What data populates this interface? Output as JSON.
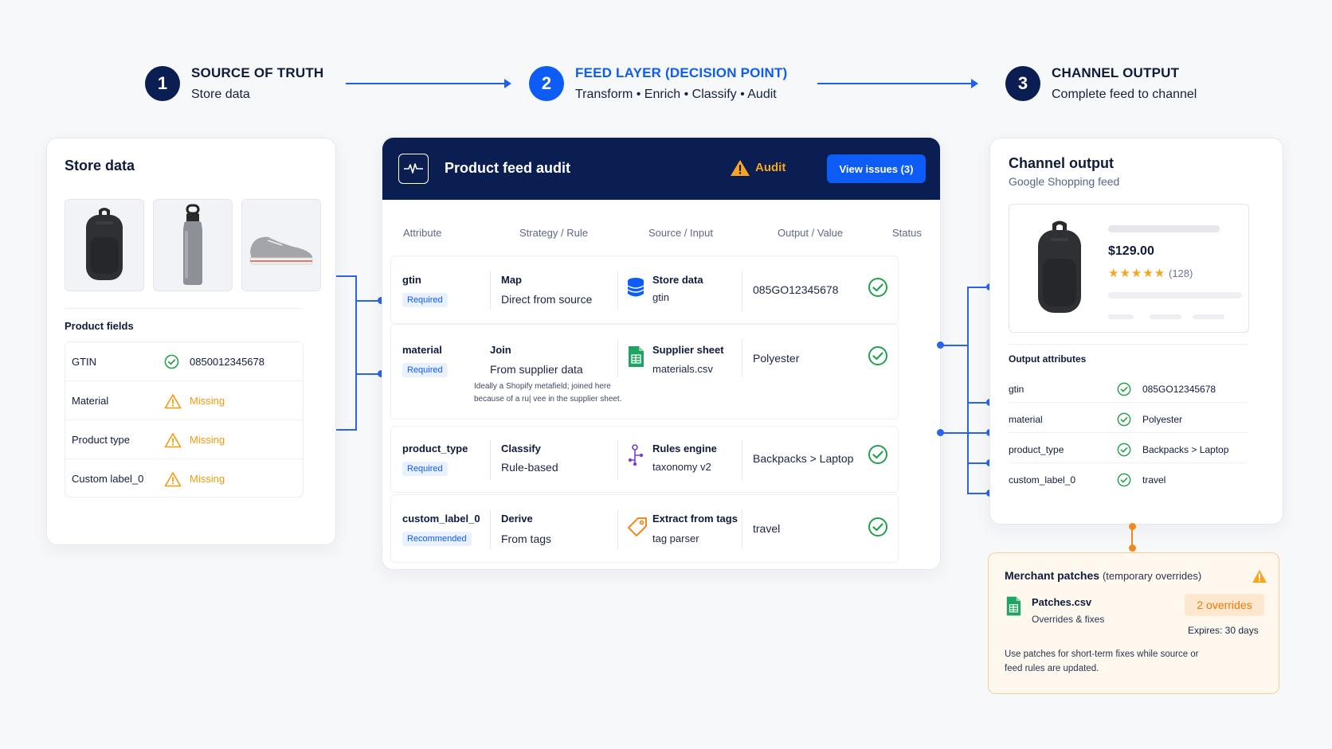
{
  "steps": [
    {
      "num": "1",
      "title": "SOURCE OF TRUTH",
      "subtitle": "Store data"
    },
    {
      "num": "2",
      "title": "FEED LAYER (DECISION POINT)",
      "subtitle": "Transform • Enrich • Classify • Audit"
    },
    {
      "num": "3",
      "title": "CHANNEL OUTPUT",
      "subtitle": "Complete feed to channel"
    }
  ],
  "store": {
    "title": "Store data",
    "fields_label": "Product fields",
    "fields": [
      {
        "name": "GTIN",
        "value": "0850012345678",
        "status": "ok"
      },
      {
        "name": "Material",
        "value": "Missing",
        "status": "missing"
      },
      {
        "name": "Product type",
        "value": "Missing",
        "status": "missing"
      },
      {
        "name": "Custom label_0",
        "value": "Missing",
        "status": "missing"
      }
    ]
  },
  "audit": {
    "title": "Product feed audit",
    "status_label": "Audit",
    "view_issues": "View issues (3)",
    "columns": [
      "Attribute",
      "Strategy / Rule",
      "Source / Input",
      "Output / Value",
      "Status"
    ],
    "rows": [
      {
        "attribute": "gtin",
        "badge": "Required",
        "strategy": "Map",
        "strategy_detail": "Direct from source",
        "source": "Store data",
        "source_detail": "gtin",
        "source_icon": "database-icon",
        "output": "085GO12345678"
      },
      {
        "attribute": "material",
        "badge": "Required",
        "strategy": "Join",
        "strategy_detail": "From supplier data",
        "source": "Supplier sheet",
        "source_detail": "materials.csv",
        "source_icon": "spreadsheet-icon",
        "output": "Polyester",
        "note_line1": "Ideally a Shopify metafield; joined here",
        "note_line2": "because of a ru| vee in the supplier sheet."
      },
      {
        "attribute": "product_type",
        "badge": "Required",
        "strategy": "Classify",
        "strategy_detail": "Rule-based",
        "source": "Rules engine",
        "source_detail": "taxonomy v2",
        "source_icon": "rules-engine-icon",
        "output": "Backpacks > Laptop"
      },
      {
        "attribute": "custom_label_0",
        "badge": "Recommended",
        "strategy": "Derive",
        "strategy_detail": "From tags",
        "source": "Extract from tags",
        "source_detail": "tag parser",
        "source_icon": "tag-icon",
        "output": "travel"
      }
    ]
  },
  "channel": {
    "title": "Channel output",
    "subtitle": "Google Shopping feed",
    "price": "$129.00",
    "stars": "★★★★★",
    "reviews": "(128)",
    "rating_fraction": 0.9,
    "output_attributes_label": "Output attributes",
    "attributes": [
      {
        "name": "gtin",
        "value": "085GO12345678"
      },
      {
        "name": "material",
        "value": "Polyester"
      },
      {
        "name": "product_type",
        "value": "Backpacks > Laptop"
      },
      {
        "name": "custom_label_0",
        "value": "travel"
      }
    ]
  },
  "patches": {
    "title": "Merchant patches",
    "title_sub": "(temporary overrides)",
    "file": "Patches.csv",
    "file_sub": "Overrides & fixes",
    "badge": "2 overrides",
    "expires": "Expires: 30 days",
    "note": "Use patches for short-term fixes while source or feed rules are updated."
  },
  "colors": {
    "navy": "#0b1e52",
    "accent": "#0d5cf5",
    "warning": "#f39a0d",
    "success": "#22a04b"
  }
}
